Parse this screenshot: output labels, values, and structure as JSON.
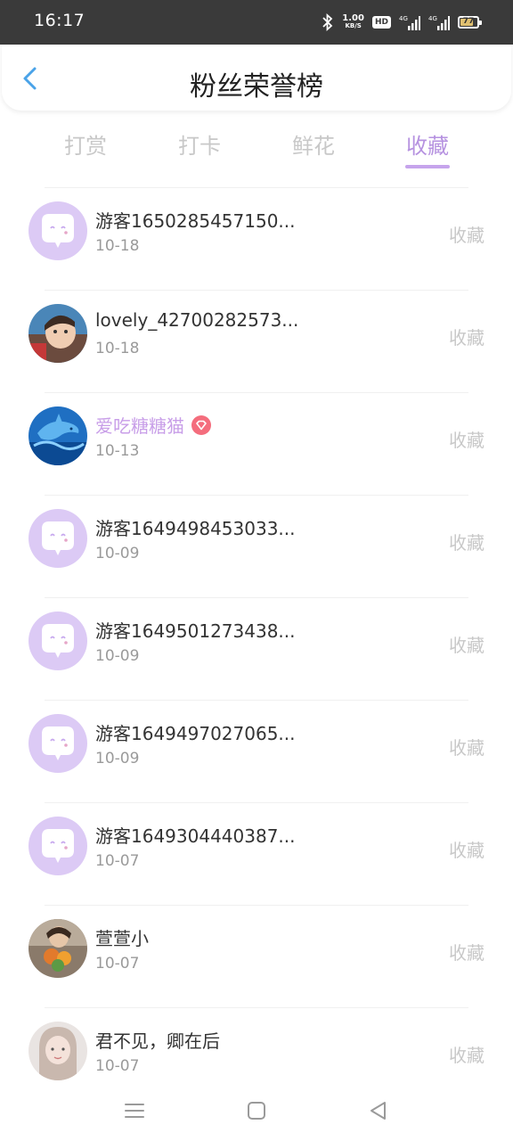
{
  "status_bar": {
    "time": "16:17",
    "net_speed": "1.00",
    "net_unit": "KB/S",
    "hd_label": "HD",
    "battery": "77"
  },
  "header": {
    "title": "粉丝荣誉榜"
  },
  "tabs": [
    {
      "label": "打赏",
      "active": false
    },
    {
      "label": "打卡",
      "active": false
    },
    {
      "label": "鲜花",
      "active": false
    },
    {
      "label": "收藏",
      "active": true
    }
  ],
  "fans": [
    {
      "name": "游客1650285457150...",
      "date": "10-18",
      "action": "收藏",
      "avatar": "guest"
    },
    {
      "name": "lovely_42700282573...",
      "date": "10-18",
      "action": "收藏",
      "avatar": "photo-child"
    },
    {
      "name": "爱吃糖糖猫",
      "date": "10-13",
      "action": "收藏",
      "avatar": "dolphin",
      "vip": true
    },
    {
      "name": "游客1649498453033...",
      "date": "10-09",
      "action": "收藏",
      "avatar": "guest"
    },
    {
      "name": "游客1649501273438...",
      "date": "10-09",
      "action": "收藏",
      "avatar": "guest"
    },
    {
      "name": "游客1649497027065...",
      "date": "10-09",
      "action": "收藏",
      "avatar": "guest"
    },
    {
      "name": "游客1649304440387...",
      "date": "10-07",
      "action": "收藏",
      "avatar": "guest"
    },
    {
      "name": "萱萱小",
      "date": "10-07",
      "action": "收藏",
      "avatar": "photo-flowers"
    },
    {
      "name": "君不见，卿在后",
      "date": "10-07",
      "action": "收藏",
      "avatar": "photo-woman"
    }
  ],
  "colors": {
    "accent": "#b692e0",
    "guest_avatar_bg": "#dccaf5",
    "status_bar": "#3a3a3a"
  }
}
